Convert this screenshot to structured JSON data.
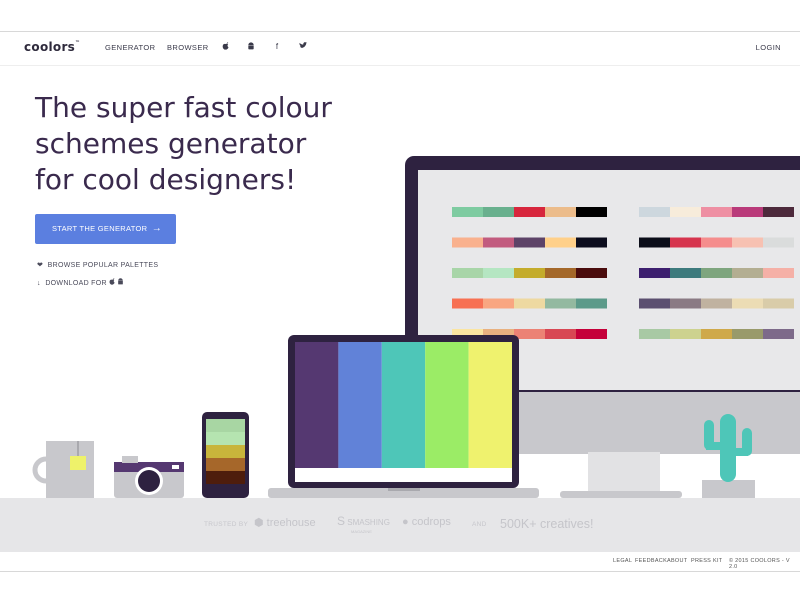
{
  "nav": {
    "logo": "coolors",
    "logo_tm": "™",
    "generator": "GENERATOR",
    "browser": "BROWSER",
    "icons": [
      "apple-icon",
      "android-icon",
      "facebook-icon",
      "twitter-icon"
    ],
    "login": "LOGIN"
  },
  "hero": {
    "headline_line1": "The super fast colour",
    "headline_line2": "schemes generator",
    "headline_line3": "for cool designers!",
    "cta_label": "START THE GENERATOR",
    "browse_label": "BROWSE POPULAR PALETTES",
    "download_label": "DOWNLOAD FOR"
  },
  "illustration": {
    "monitor_palettes": [
      [
        "#7ecba1",
        "#69b08e",
        "#d7263d",
        "#ecbc8b",
        "#000000"
      ],
      [
        "#cdd7de",
        "#f7ecdb",
        "#ee8fa3",
        "#b93a7a",
        "#4d2a3c"
      ],
      [
        "#f9b18e",
        "#c25b7f",
        "#5d4368",
        "#ffd08a",
        "#0c0d1e"
      ],
      [
        "#0b0d19",
        "#d6344e",
        "#f58d8d",
        "#f7c1b2",
        "#dadcdc"
      ],
      [
        "#a8d5a8",
        "#b5e6c2",
        "#c4ac2c",
        "#a4682a",
        "#4a0c0d"
      ],
      [
        "#3d1f6f",
        "#3d7a7d",
        "#7ea57e",
        "#b3ae92",
        "#f5b0a7"
      ],
      [
        "#f77053",
        "#f9a681",
        "#eed9a1",
        "#93b9a0",
        "#5c9a8a"
      ],
      [
        "#5b4f70",
        "#8a7a84",
        "#c0b2a0",
        "#ecdcb4",
        "#d9cca9"
      ],
      [
        "#fbe5a1",
        "#e9b180",
        "#ec8275",
        "#d84754",
        "#c5003a"
      ],
      [
        "#a8c9a4",
        "#cdd28f",
        "#cfa94a",
        "#999a6b",
        "#7d6a8a"
      ]
    ],
    "laptop_stripes": [
      "#553871",
      "#6182d8",
      "#4ec6b8",
      "#9bec66",
      "#eff26e"
    ],
    "phone_stripes": [
      "#a8d6a3",
      "#b5e4b0",
      "#c8b53b",
      "#a6672a",
      "#4e1d0c"
    ]
  },
  "colors": {
    "accent": "#5b7fe0",
    "dark": "#3a2a4d",
    "band": "#e6e6e8"
  },
  "trust": {
    "trusted_by": "TRUSTED BY",
    "treehouse": "treehouse",
    "smashing": "SMASHING",
    "smashing_sub": "MAGAZINE",
    "codrops": "codrops",
    "and": "AND",
    "creatives": "500K+ creatives!"
  },
  "footer": {
    "legal": "LEGAL",
    "feedback": "FEEDBACK",
    "about": "ABOUT",
    "presskit": "PRESS KIT",
    "copyright": "© 2015 COOLORS - V 2.0"
  }
}
